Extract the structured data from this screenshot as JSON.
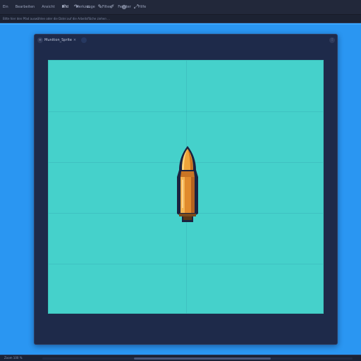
{
  "menubar": {
    "items": [
      "Ein",
      "Bearbeiten",
      "Ansicht",
      "Bild",
      "Werkzeuge",
      "Filter",
      "Fenster",
      "Hilfe"
    ],
    "active_index": 3
  },
  "toolbar": {
    "icons": [
      "undo-icon",
      "redo-icon",
      "crop-icon",
      "brush-icon",
      "eraser-icon",
      "fill-icon",
      "transform-icon"
    ],
    "glyphs": [
      "↶",
      "↷",
      "⌗",
      "✎",
      "✐",
      "◍",
      "⤢"
    ]
  },
  "pathbar": {
    "text": "Bitte hier den Pfad auswählen oder die Datei auf die Arbeitsfläche ziehen ..."
  },
  "window": {
    "title": "Munition_Sprite",
    "close_glyph": "×",
    "menu_glyph": "≡",
    "option_glyph": "⁝"
  },
  "canvas": {
    "background": "#45d1cb",
    "sprite": "bullet-sprite"
  },
  "statusbar": {
    "text": "Zoom 100 %",
    "scroll_fraction": 0.44
  }
}
